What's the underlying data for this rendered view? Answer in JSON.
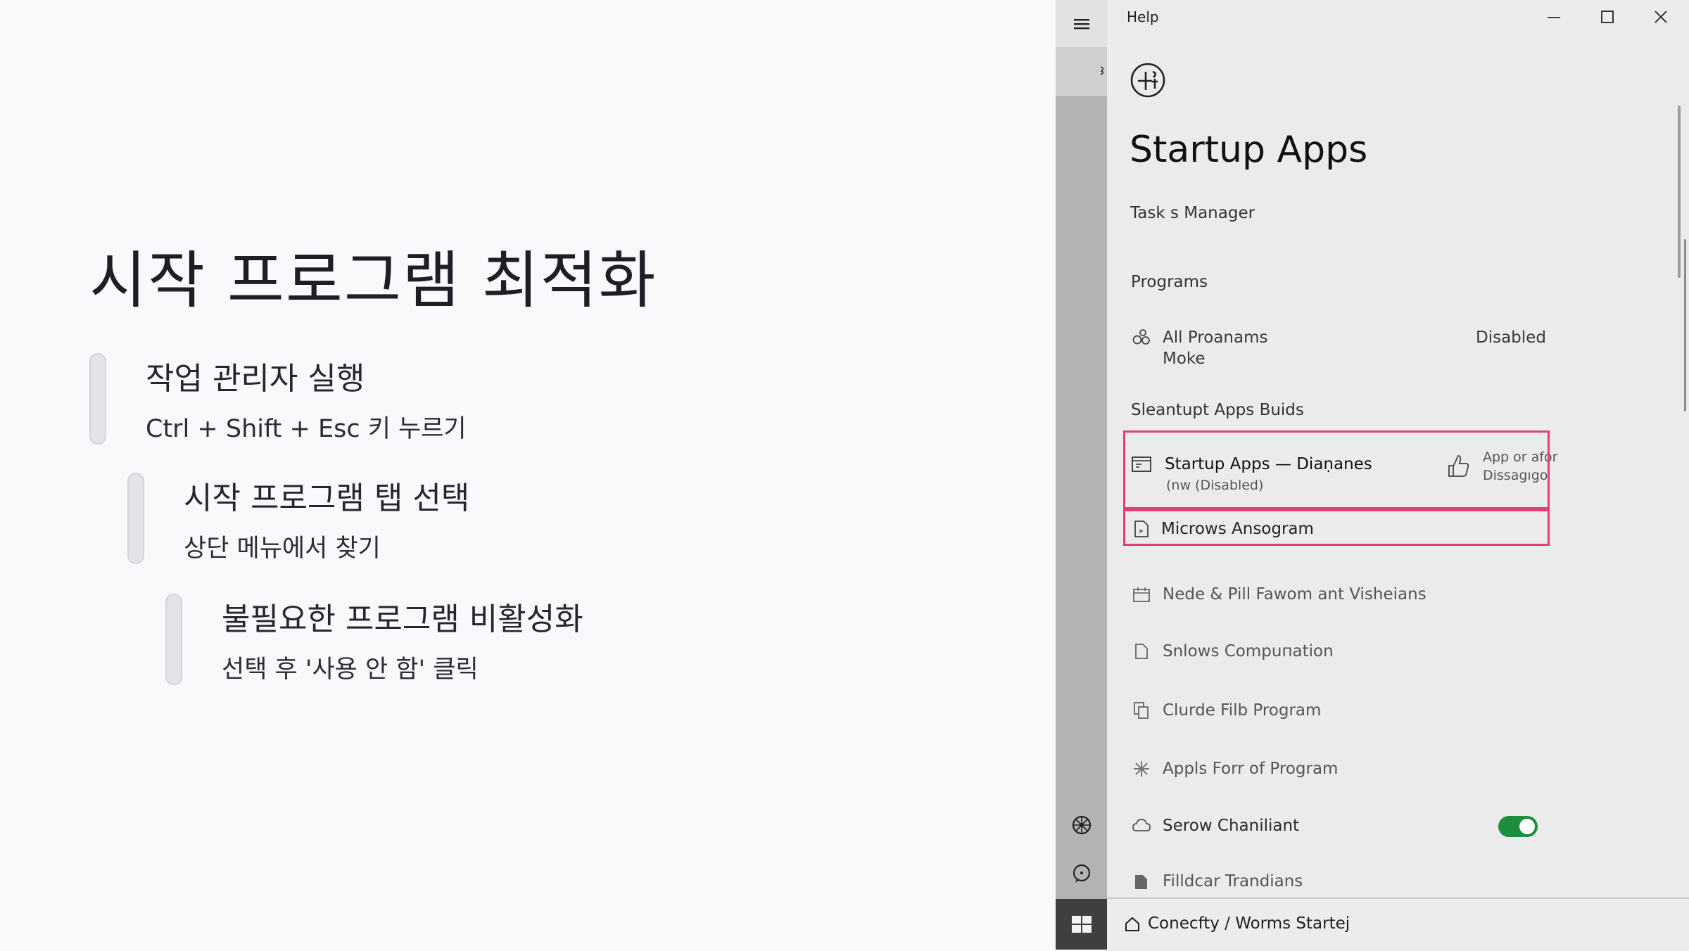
{
  "slide": {
    "title": "시작 프로그램 최적화",
    "steps": [
      {
        "title": "작업 관리자 실행",
        "desc": "Ctrl + Shift + Esc 키 누르기"
      },
      {
        "title": "시작 프로그램 탭 선택",
        "desc": "상단 메뉴에서 찾기"
      },
      {
        "title": "불필요한 프로그램 비활성화",
        "desc": "선택 후 '사용 안 함' 클릭"
      }
    ]
  },
  "window": {
    "title": "Help",
    "controls": {
      "minimize": "minimize-icon",
      "maximize": "maximize-icon",
      "close": "close-icon"
    },
    "page_title": "Startup Apps",
    "subtitle": "Task s Manager",
    "sections": {
      "programs": "Programs",
      "builds": "Sleantupt Apps Buids"
    },
    "all_programs": {
      "line1": "All Proanams",
      "line2": "Moke",
      "status": "Disabled"
    },
    "highlighted": {
      "title": "Startup Apps — Diaṇanes",
      "sub": "(nw (Disabled)",
      "action_line1": "App or afor",
      "action_line2": "Dissagıgo",
      "second": "Microws Ansogram"
    },
    "items": [
      {
        "label": "Nede & Pill Fawom ant Visheians"
      },
      {
        "label": "Snlows Compuпation"
      },
      {
        "label": "Clurde Filb Program"
      },
      {
        "label": "Appls Forr of Program"
      },
      {
        "label": "Serow Chaniliant",
        "toggle": true
      },
      {
        "label": "Filldcar Trandians"
      }
    ],
    "status_bar": "Conecfty / Worms Startej",
    "accent_color": "#1b8f3c",
    "highlight_color": "#e0407a"
  }
}
